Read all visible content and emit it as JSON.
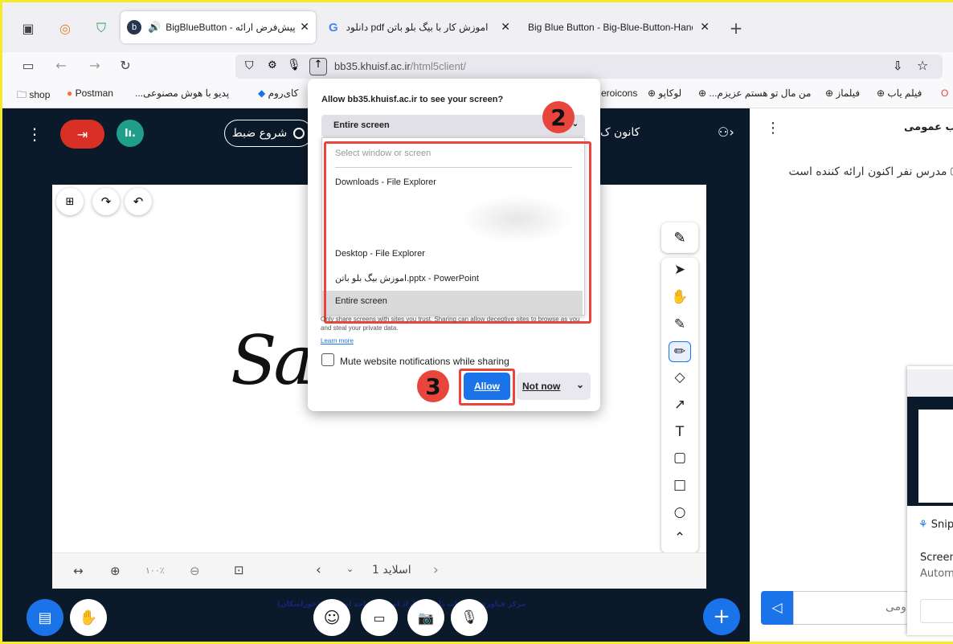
{
  "tabs": [
    {
      "title": "BigBlueButton - پیش‌فرض ارائه",
      "close": "✕"
    },
    {
      "title": "دانلود pdf اموزش کار با بیگ بلو باتن ·",
      "close": "✕"
    },
    {
      "title": "Big Blue Button - Big-Blue-Button-Handi",
      "close": "✕"
    }
  ],
  "new_tab": "+",
  "address": {
    "domain": "bb35.khuisf.ac.ir",
    "path": "/html5client/"
  },
  "bookmarks": [
    "shop",
    "Postman",
    "...پدیو با هوش مصنوعی",
    "کای‌روم",
    "eroicons",
    "لوکاپو",
    "...من مال تو هستم عزیزم",
    "فیلماز",
    "فیلم یاب"
  ],
  "meeting": {
    "record_label": "شروع ضبط",
    "title_fragment": "کانون ک",
    "slide_label": "اسلاید 1",
    "zoom": "۱۰۰٪",
    "slide_footer": "مرکز فناوری اطلاعات دانشگاه آزاد اسلامی واحد اصفهان (خوراسکان)",
    "handwriting": "Sa"
  },
  "sidebar": {
    "chat_title": "ب عمومی",
    "presenter_text": "مدرس نفر اکنون ارائه کننده است",
    "message_placeholder": "ومی"
  },
  "share_popup": {
    "prompt": "Allow bb35.khuisf.ac.ir to see your screen?",
    "selected": "Entire screen",
    "list_header": "Select window or screen",
    "options": [
      "Downloads - File Explorer",
      "Desktop - File Explorer",
      "اموزش بیگ بلو باتن.pptx - PowerPoint",
      "Entire screen"
    ],
    "warning": "Only share screens with sites you trust. Sharing can allow deceptive sites to browse as you and steal your private data.",
    "learn_more": "Learn more",
    "mute_label": "Mute website notifications while sharing",
    "allow": "Allow",
    "not_now": "Not now"
  },
  "annotations": {
    "step2": "2",
    "step3": "3"
  },
  "snip_panel": {
    "app": "Snip",
    "line1": "Screen",
    "line2": "Autom"
  },
  "colors": {
    "accent_blue": "#1a73e8",
    "annotation_red": "#e8453c",
    "leave_red": "#d93025",
    "teal": "#1f9e89"
  }
}
